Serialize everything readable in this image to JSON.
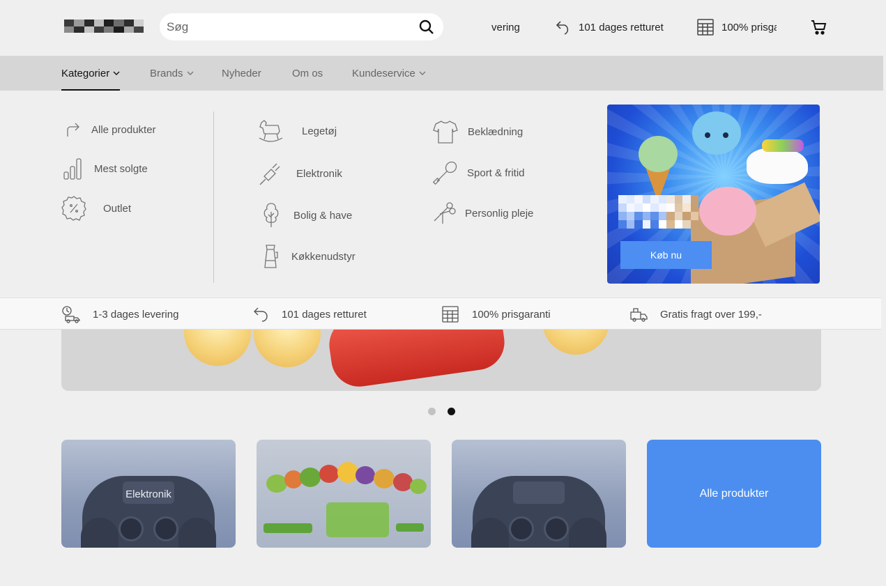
{
  "header": {
    "search_placeholder": "Søg",
    "usps": [
      "vering",
      "101 dages retturet",
      "100% prisga"
    ]
  },
  "nav": {
    "items": [
      {
        "label": "Kategorier",
        "active": true,
        "has_dropdown": true
      },
      {
        "label": "Brands",
        "active": false,
        "has_dropdown": true
      },
      {
        "label": "Nyheder",
        "active": false,
        "has_dropdown": false
      },
      {
        "label": "Om os",
        "active": false,
        "has_dropdown": false
      },
      {
        "label": "Kundeservice",
        "active": false,
        "has_dropdown": true
      }
    ]
  },
  "dropdown": {
    "quick_links": [
      {
        "label": "Alle produkter",
        "icon": "arrow-turn-icon"
      },
      {
        "label": "Mest solgte",
        "icon": "bar-chart-icon"
      },
      {
        "label": "Outlet",
        "icon": "percent-badge-icon"
      }
    ],
    "categories_col1": [
      {
        "label": "Legetøj",
        "icon": "rocking-horse-icon"
      },
      {
        "label": "Elektronik",
        "icon": "plug-icon"
      },
      {
        "label": "Bolig & have",
        "icon": "tree-icon"
      },
      {
        "label": "Køkkenudstyr",
        "icon": "blender-icon"
      }
    ],
    "categories_col2": [
      {
        "label": "Beklædning",
        "icon": "tshirt-icon"
      },
      {
        "label": "Sport & fritid",
        "icon": "racket-icon"
      },
      {
        "label": "Personlig pleje",
        "icon": "scissors-icon"
      }
    ],
    "promo": {
      "button_label": "Køb nu"
    }
  },
  "usp_bar": {
    "items": [
      {
        "label": "1-3 dages levering",
        "icon": "delivery-truck-clock-icon"
      },
      {
        "label": "101 dages retturet",
        "icon": "return-arrow-icon"
      },
      {
        "label": "100% prisgaranti",
        "icon": "calculator-icon"
      },
      {
        "label": "Gratis fragt over 199,-",
        "icon": "truck-icon"
      }
    ]
  },
  "carousel": {
    "slides": 2,
    "active_index": 1
  },
  "tiles": [
    {
      "label": "Elektronik",
      "kind": "controller"
    },
    {
      "label": "",
      "kind": "vegetables"
    },
    {
      "label": "",
      "kind": "controller"
    },
    {
      "label": "Alle produkter",
      "kind": "link"
    }
  ],
  "colors": {
    "accent": "#4c8ef2",
    "nav_bg": "#d6d6d6",
    "page_bg": "#efefef"
  }
}
